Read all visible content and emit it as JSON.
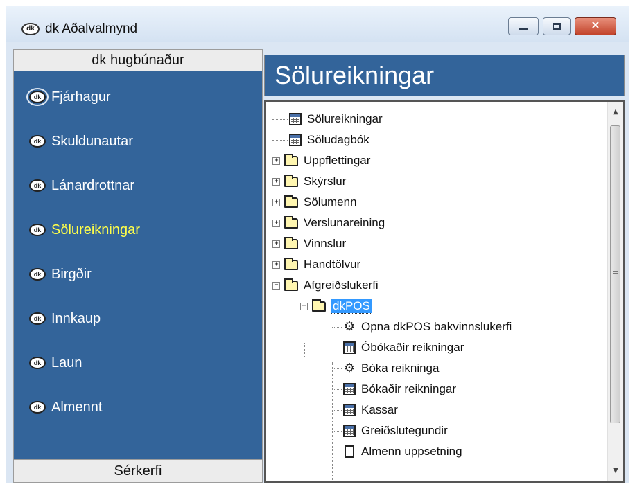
{
  "window": {
    "title": "dk Aðalvalmynd",
    "icon": "dk",
    "buttons": {
      "minimize": "minimize-icon",
      "maximize": "maximize-icon",
      "close": "×"
    }
  },
  "sidebar": {
    "header": "dk hugbúnaður",
    "footer": "Sérkerfi",
    "items": [
      {
        "label": "Fjárhagur",
        "icon": "dk",
        "active": false
      },
      {
        "label": "Skuldunautar",
        "icon": "dk",
        "active": false
      },
      {
        "label": "Lánardrottnar",
        "icon": "dk",
        "active": false
      },
      {
        "label": "Sölureikningar",
        "icon": "dk",
        "active": true
      },
      {
        "label": "Birgðir",
        "icon": "dk",
        "active": false
      },
      {
        "label": "Innkaup",
        "icon": "dk",
        "active": false
      },
      {
        "label": "Laun",
        "icon": "dk",
        "active": false
      },
      {
        "label": "Almennt",
        "icon": "dk",
        "active": false
      }
    ],
    "colors": {
      "background": "#33649a",
      "active_text": "#ffff4a",
      "text": "#ffffff"
    }
  },
  "main": {
    "title": "Sölureikningar",
    "tree": [
      {
        "label": "Sölureikningar",
        "icon": "table-icon"
      },
      {
        "label": "Söludagbók",
        "icon": "table-icon"
      },
      {
        "label": "Uppflettingar",
        "icon": "folder-icon",
        "expander": "+"
      },
      {
        "label": "Skýrslur",
        "icon": "folder-icon",
        "expander": "+"
      },
      {
        "label": "Sölumenn",
        "icon": "folder-icon",
        "expander": "+"
      },
      {
        "label": "Verslunareining",
        "icon": "folder-icon",
        "expander": "+"
      },
      {
        "label": "Vinnslur",
        "icon": "folder-icon",
        "expander": "+"
      },
      {
        "label": "Handtölvur",
        "icon": "folder-icon",
        "expander": "+"
      },
      {
        "label": "Afgreiðslukerfi",
        "icon": "folder-icon",
        "expander": "−"
      },
      {
        "label": "dkPOS",
        "icon": "folder-icon",
        "expander": "−",
        "selected": true
      },
      {
        "label": "Opna dkPOS bakvinnslukerfi",
        "icon": "gear-icon"
      },
      {
        "label": "Óbókaðir reikningar",
        "icon": "grid-icon"
      },
      {
        "label": "Bóka reikninga",
        "icon": "gear-icon"
      },
      {
        "label": "Bókaðir reikningar",
        "icon": "grid-icon"
      },
      {
        "label": "Kassar",
        "icon": "grid-icon"
      },
      {
        "label": "Greiðslutegundir",
        "icon": "grid-icon"
      },
      {
        "label": "Almenn uppsetning",
        "icon": "document-icon"
      }
    ],
    "selection_color": "#3399ff"
  }
}
